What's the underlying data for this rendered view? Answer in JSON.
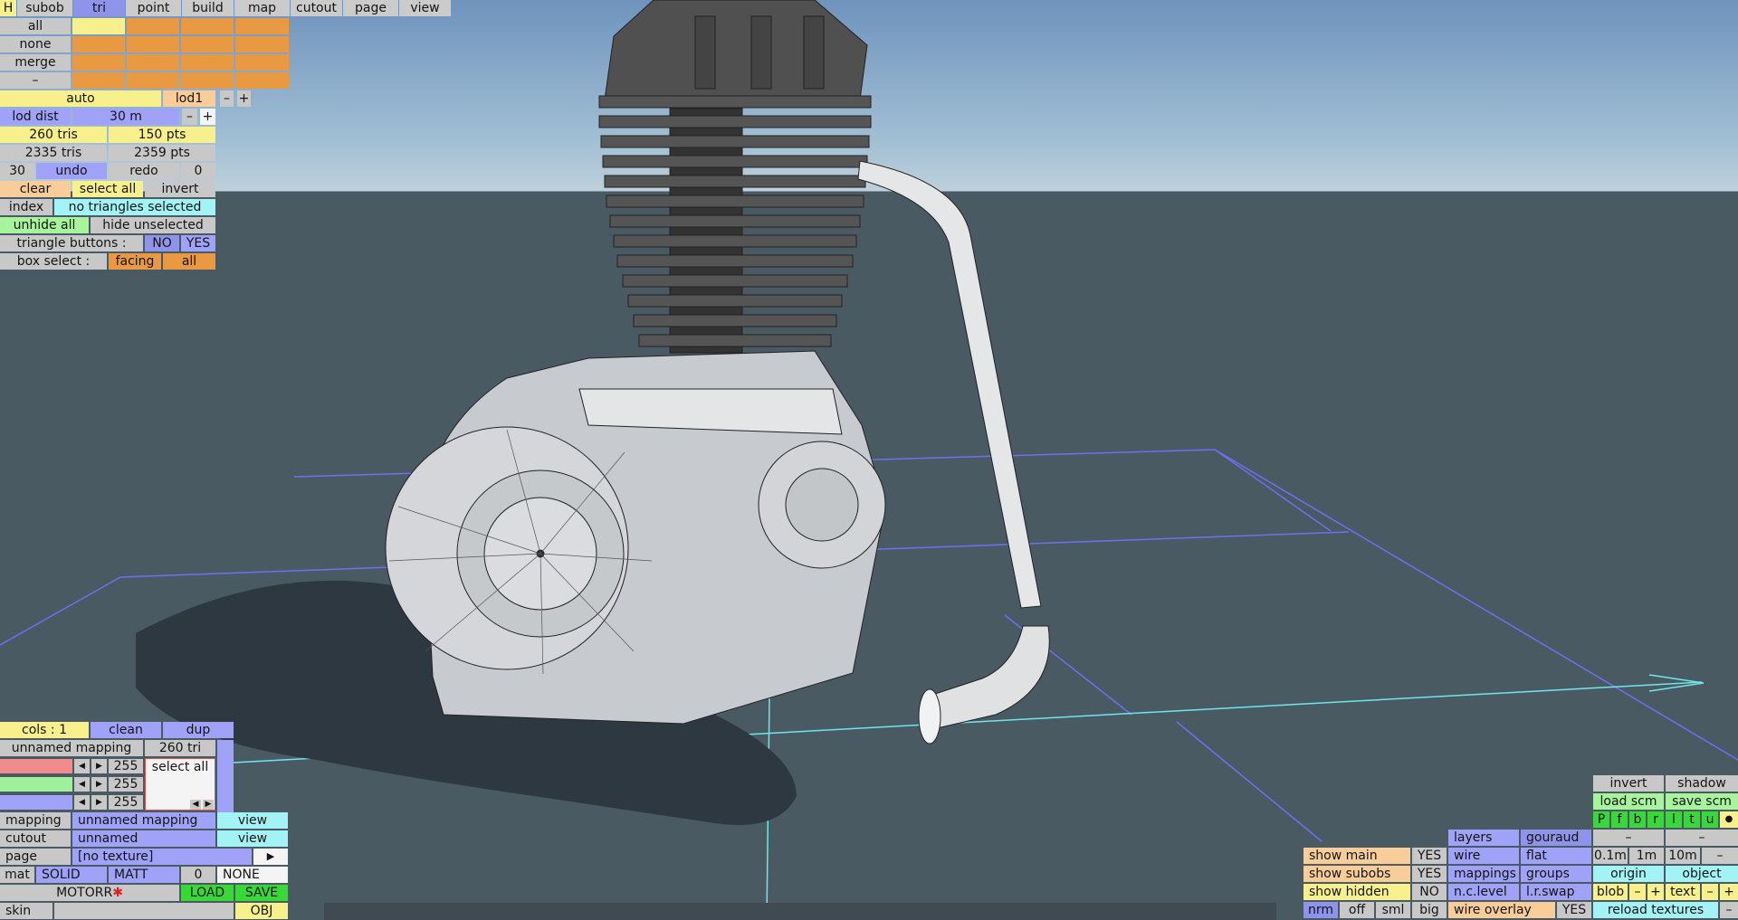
{
  "tabs": {
    "h": "H",
    "subob": "subob",
    "tri": "tri",
    "point": "point",
    "build": "build",
    "map": "map",
    "cutout": "cutout",
    "page": "page",
    "view": "view"
  },
  "select": {
    "all": "all",
    "none": "none",
    "merge": "merge",
    "dash": "–"
  },
  "lod": {
    "auto": "auto",
    "lod1": "lod1",
    "minus": "–",
    "plus": "+",
    "dist_label": "lod dist",
    "dist_value": "30 m"
  },
  "stats": {
    "tris": "260 tris",
    "pts": "150 pts",
    "total_tris": "2335 tris",
    "total_pts": "2359 pts"
  },
  "history": {
    "count": "30",
    "undo": "undo",
    "redo": "redo",
    "zero": "0"
  },
  "actions": {
    "clear": "clear",
    "select_all": "select all",
    "invert": "invert",
    "index": "index",
    "selection_status": "no triangles selected",
    "unhide_all": "unhide all",
    "hide_unselected": "hide unselected",
    "triangle_buttons": "triangle buttons :",
    "no": "NO",
    "yes": "YES",
    "box_select": "box select :",
    "facing": "facing",
    "all": "all"
  },
  "cols": {
    "cols": "cols : 1",
    "clean": "clean",
    "dup": "dup",
    "mapping_name": "unnamed mapping",
    "tri_count": "260 tri",
    "r": "255",
    "g": "255",
    "b": "255",
    "select_all": "select all",
    "left": "◀",
    "right": "▶"
  },
  "props": {
    "mapping": "mapping",
    "mapping_value": "unnamed mapping",
    "cutout": "cutout",
    "cutout_value": "unnamed",
    "view": "view",
    "page": "page",
    "page_value": "[no texture]",
    "play": "▶",
    "mat": "mat",
    "solid": "SOLID",
    "matt": "MATT",
    "mat_zero": "0",
    "none": "NONE",
    "model_name": "MOTORR",
    "modified_mark": "✱",
    "load": "LOAD",
    "save": "SAVE",
    "skin": "skin",
    "obj": "OBJ"
  },
  "display": {
    "invert": "invert",
    "shadow": "shadow",
    "load_scm": "load scm",
    "save_scm": "save scm",
    "flags": [
      "P",
      "f",
      "b",
      "r",
      "l",
      "t",
      "u"
    ],
    "dot": "●",
    "dash": "–",
    "layers": "layers",
    "gouraud": "gouraud",
    "show_main": "show main",
    "yes": "YES",
    "wire": "wire",
    "flat": "flat",
    "d01": "0.1m",
    "d1": "1m",
    "d10": "10m",
    "show_subobs": "show subobs",
    "mappings": "mappings",
    "groups": "groups",
    "origin": "origin",
    "object": "object",
    "show_hidden": "show hidden",
    "no": "NO",
    "nclevel": "n.c.level",
    "lrswap": "l.r.swap",
    "blob": "blob",
    "minus": "–",
    "plus": "+",
    "text": "text",
    "nrm": "nrm",
    "off": "off",
    "sml": "sml",
    "big": "big",
    "wire_overlay": "wire overlay",
    "reload_textures": "reload textures"
  },
  "colors": {
    "yellow": "#f8ef8d",
    "orange": "#e89942",
    "blue": "#9fa2f7",
    "cyan": "#a3f3f6",
    "green": "#a7f49d",
    "grey": "#cbcbcb",
    "sky": "#8fb0cc",
    "floor": "#4a5a63"
  }
}
